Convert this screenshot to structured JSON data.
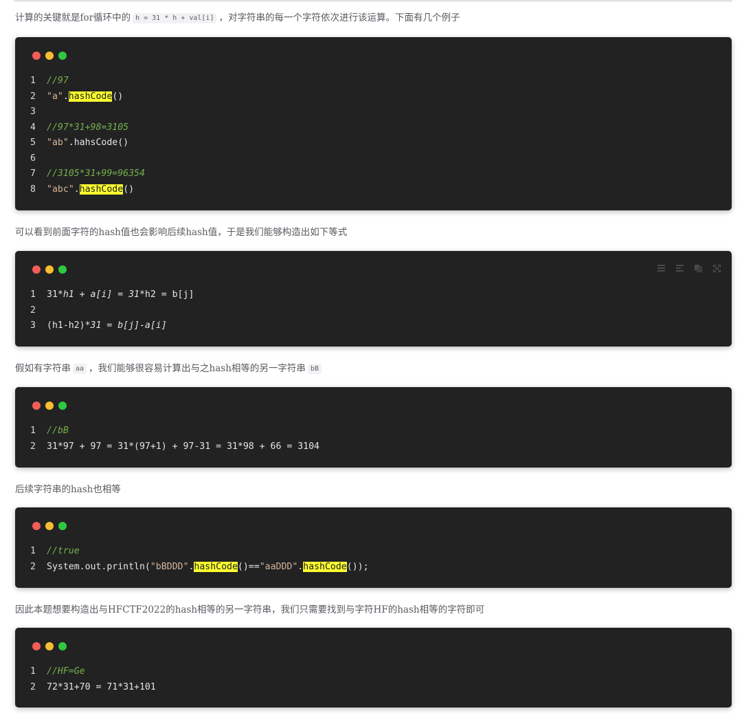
{
  "paragraphs": {
    "p1": {
      "before": "计算的关键就是for循环中的",
      "code": "h = 31 * h + val[i]",
      "after": "，对字符串的每一个字符依次进行该运算。下面有几个例子"
    },
    "p2": "可以看到前面字符的hash值也会影响后续hash值，于是我们能够构造出如下等式",
    "p3": {
      "before": "假如有字符串",
      "code1": "aa",
      "middle": "，我们能够很容易计算出与之hash相等的另一字符串",
      "code2": "bB"
    },
    "p4": "后续字符串的hash也相等",
    "p5": "因此本题想要构造出与HFCTF2022的hash相等的另一字符串，我们只需要找到与字符HF的hash相等的字符即可"
  },
  "code_blocks": [
    {
      "lines": [
        {
          "num": "1",
          "comment": "//97"
        },
        {
          "num": "2",
          "str": "\"a\"",
          "dot": ".",
          "hl": "hashCode",
          "rest": "()"
        },
        {
          "num": "3"
        },
        {
          "num": "4",
          "comment": "//97*31+98=3105"
        },
        {
          "num": "5",
          "str": "\"ab\"",
          "rest": ".hahsCode()"
        },
        {
          "num": "6"
        },
        {
          "num": "7",
          "comment": "//3105*31+99=96354"
        },
        {
          "num": "8",
          "str": "\"abc\"",
          "dot": ".",
          "hl": "hashCode",
          "rest": "()"
        }
      ]
    },
    {
      "toolbar": [
        "list-icon",
        "align-icon",
        "copy-icon",
        "fullscreen-icon"
      ],
      "lines": [
        {
          "num": "1",
          "a": "31",
          "b": "*h1 + a[i] = 31",
          "c": "*h2 = b[j]"
        },
        {
          "num": "2"
        },
        {
          "num": "3",
          "a": "(h1-h2)",
          "b": "*31 = b[j]-a[i]"
        }
      ]
    },
    {
      "lines": [
        {
          "num": "1",
          "comment": "//bB"
        },
        {
          "num": "2",
          "code": "31*97 + 97 = 31*(97+1) + 97-31 = 31*98 + 66 = 3104"
        }
      ]
    },
    {
      "lines": [
        {
          "num": "1",
          "comment": "//true"
        },
        {
          "num": "2",
          "pre": "System.out.println(",
          "s1": "\"bBDDD\"",
          "d1": ".",
          "h1": "hashCode",
          "mid": "()==",
          "s2": "\"aaDDD\"",
          "d2": ".",
          "h2": "hashCode",
          "end": "());"
        }
      ]
    },
    {
      "lines": [
        {
          "num": "1",
          "comment": "//HF=Ge"
        },
        {
          "num": "2",
          "code": "72*31+70 = 71*31+101"
        }
      ]
    }
  ]
}
